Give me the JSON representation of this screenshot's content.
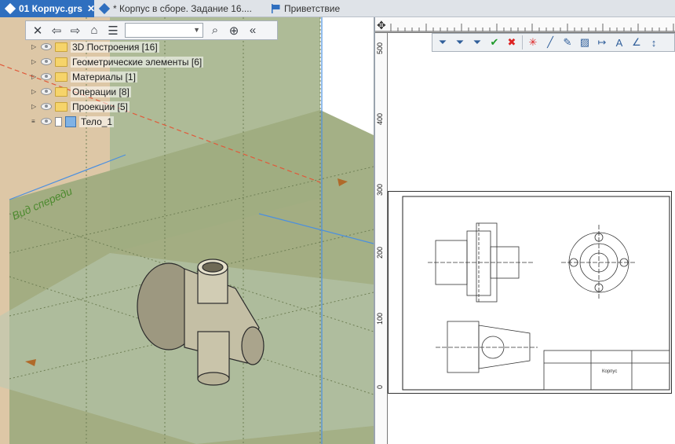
{
  "tabs": [
    {
      "label": "01 Корпус.grs",
      "active": true
    },
    {
      "label": "* Корпус в сборе. Задание 16....",
      "active": false
    },
    {
      "label": "Приветствие",
      "active": false
    }
  ],
  "viewport": {
    "view_label": "Вид спереди",
    "tree": [
      {
        "label": "3D Построения [16]",
        "icon": "folder-icon"
      },
      {
        "label": "Геометрические элементы [6]",
        "icon": "folder-icon"
      },
      {
        "label": "Материалы [1]",
        "icon": "folder-icon"
      },
      {
        "label": "Операции [8]",
        "icon": "folder-icon"
      },
      {
        "label": "Проекции [5]",
        "icon": "folder-icon"
      },
      {
        "label": "Тело_1",
        "icon": "body-cube-icon"
      }
    ]
  },
  "ruler": {
    "vertical_ticks": [
      "500",
      "400",
      "300",
      "200",
      "100",
      "0"
    ]
  },
  "drawing": {
    "title_block_name": "Корпус"
  },
  "colors": {
    "tab_active": "#2f6fbf",
    "plane_front": "#8ba066",
    "plane_side": "#c9a06a",
    "plane_top": "#bcd3ea"
  }
}
